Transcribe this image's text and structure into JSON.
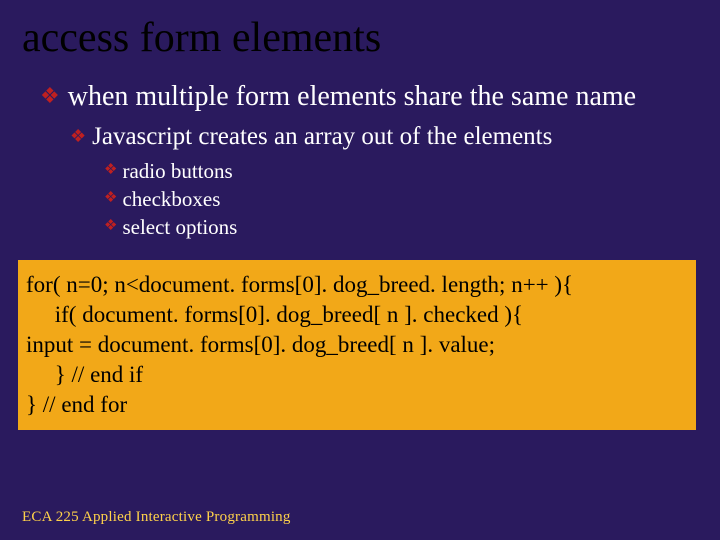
{
  "title": "access form elements",
  "bullets": {
    "lvl1": "when multiple form elements share the same name",
    "lvl2": "Javascript creates an array out of the elements",
    "lvl3": [
      "radio buttons",
      "checkboxes",
      "select options"
    ]
  },
  "code": {
    "l1": "for( n=0; n<document. forms[0]. dog_breed. length; n++ ){",
    "l2": "     if( document. forms[0]. dog_breed[ n ]. checked ){",
    "l3": "input = document. forms[0]. dog_breed[ n ]. value;",
    "l4": "     } // end if",
    "l5": "} // end for"
  },
  "footer": "ECA 225   Applied Interactive Programming"
}
